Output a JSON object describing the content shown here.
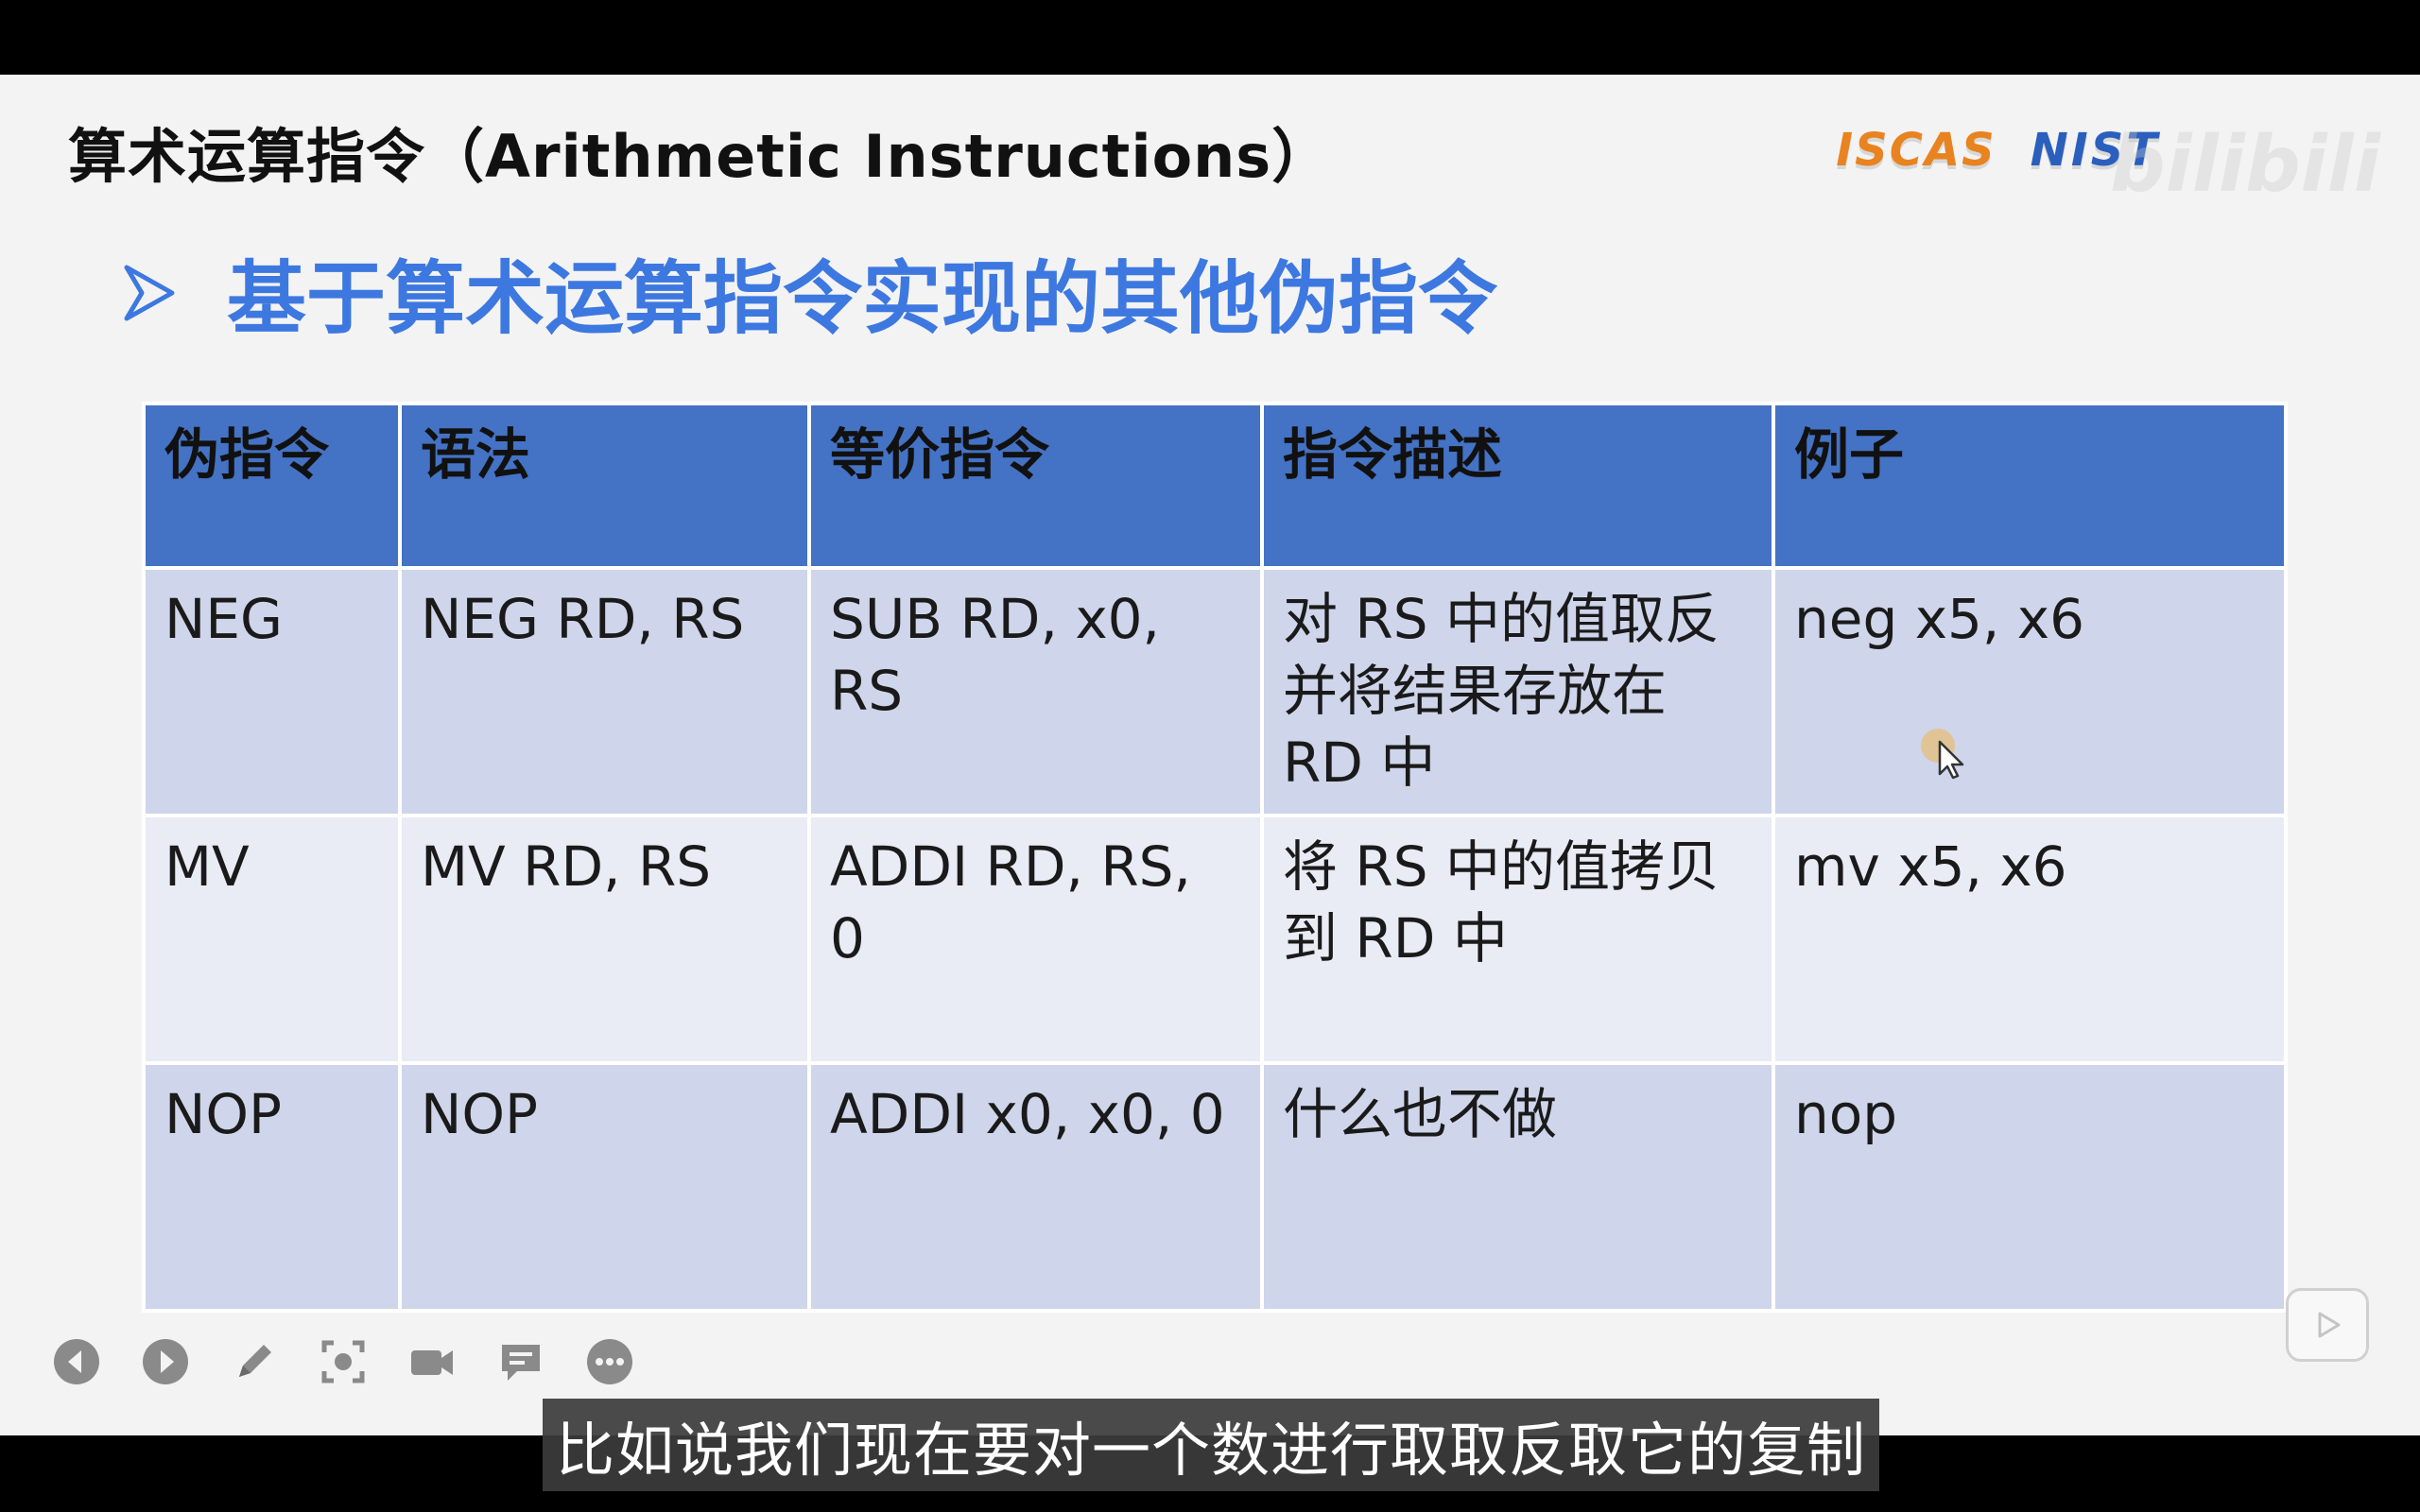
{
  "slide": {
    "title": "算术运算指令（Arithmetic Instructions）",
    "subheading": "基于算术运算指令实现的其他伪指令",
    "logos": {
      "left": "ISCAS",
      "right": "NIST",
      "watermark": "bilibili"
    }
  },
  "table": {
    "headers": [
      "伪指令",
      "语法",
      "等价指令",
      "指令描述",
      "例子"
    ],
    "rows": [
      [
        "NEG",
        "NEG RD, RS",
        "SUB RD, x0, RS",
        "对 RS 中的值取反并将结果存放在 RD 中",
        "neg x5, x6"
      ],
      [
        "MV",
        "MV RD, RS",
        "ADDI RD, RS, 0",
        "将 RS 中的值拷贝到 RD 中",
        "mv x5, x6"
      ],
      [
        "NOP",
        "NOP",
        "ADDI x0, x0, 0",
        "什么也不做",
        "nop"
      ]
    ]
  },
  "toolbar": {
    "icons": [
      "prev-icon",
      "next-icon",
      "pen-icon",
      "screenshot-icon",
      "camera-icon",
      "comment-icon",
      "more-icon"
    ]
  },
  "subtitle": {
    "text": "比如说我们现在要对一个数进行取取反取它的复制"
  },
  "colors": {
    "header_bg": "#4472c4",
    "row_odd": "#cfd5ea",
    "row_even": "#e9ebf5",
    "accent": "#3d78e0"
  }
}
